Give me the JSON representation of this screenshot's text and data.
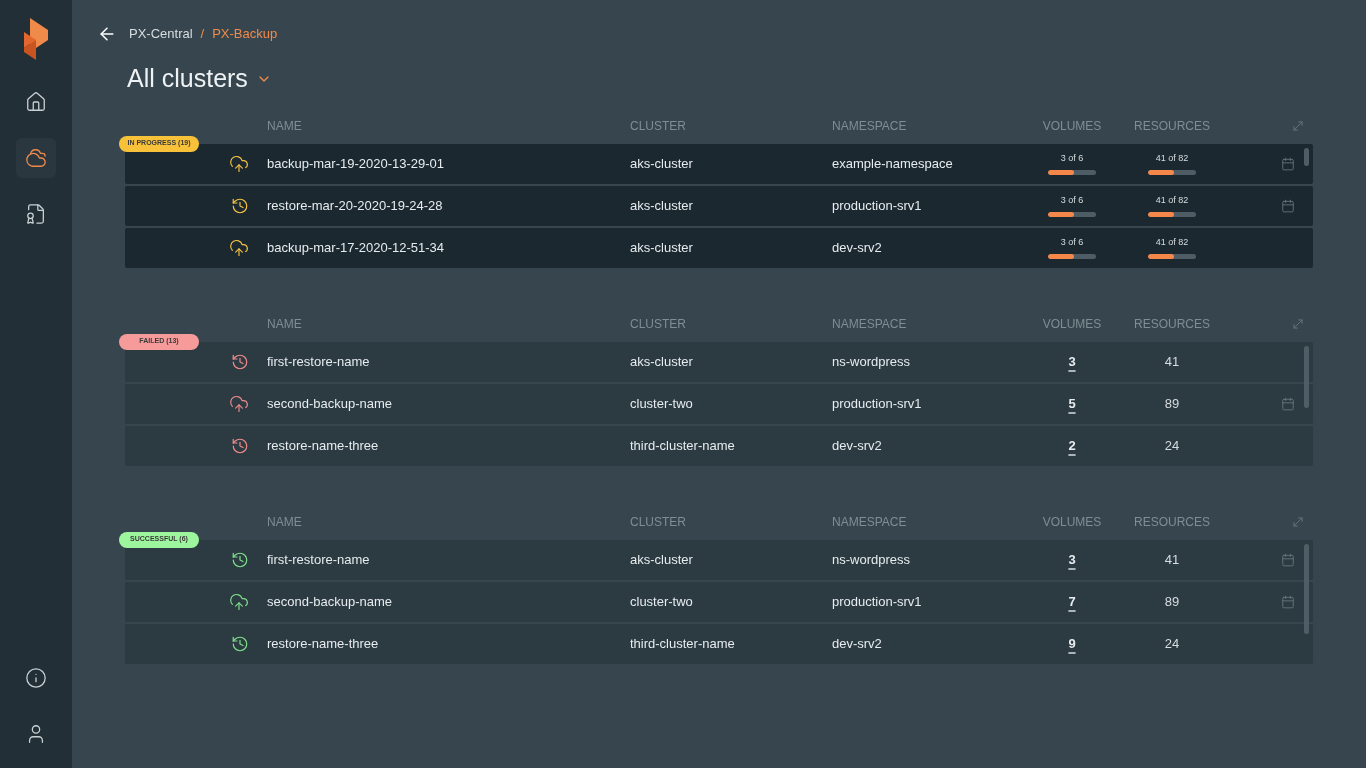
{
  "sidebar": {
    "items": [
      {
        "kind": "home",
        "selected": false
      },
      {
        "kind": "cloud",
        "selected": true
      },
      {
        "kind": "certificate",
        "selected": false
      }
    ],
    "bottom_items": [
      {
        "kind": "info"
      },
      {
        "kind": "user"
      }
    ]
  },
  "breadcrumb": {
    "separator": "/",
    "items": [
      {
        "label": "PX-Central",
        "selected": false
      },
      {
        "label": "PX-Backup",
        "selected": true
      }
    ]
  },
  "title": "All clusters",
  "sections": [
    {
      "kind": "in_progress",
      "badge": "IN PROGRESS (19)",
      "columns": [
        "NAME",
        "CLUSTER",
        "NAMESPACE",
        "VOLUMES",
        "RESOURCES"
      ],
      "rows": [
        {
          "kind": "backup",
          "name": "backup-mar-19-2020-13-29-01",
          "cluster": "aks-cluster",
          "namespace": "example-namespace",
          "volumes": {
            "kind": "progress",
            "text": "3 of 6",
            "level": 0.55
          },
          "resources": {
            "kind": "progress",
            "text": "41 of 82",
            "level": 0.55
          },
          "scheduled": true
        },
        {
          "kind": "restore",
          "name": "restore-mar-20-2020-19-24-28",
          "cluster": "aks-cluster",
          "namespace": "production-srv1",
          "volumes": {
            "kind": "progress",
            "text": "3 of 6",
            "level": 0.55
          },
          "resources": {
            "kind": "progress",
            "text": "41 of 82",
            "level": 0.55
          },
          "scheduled": true
        },
        {
          "kind": "backup",
          "name": "backup-mar-17-2020-12-51-34",
          "cluster": "aks-cluster",
          "namespace": "dev-srv2",
          "volumes": {
            "kind": "progress",
            "text": "3 of 6",
            "level": 0.55
          },
          "resources": {
            "kind": "progress",
            "text": "41 of 82",
            "level": 0.55
          },
          "scheduled": false
        }
      ]
    },
    {
      "kind": "failed",
      "badge": "FAILED (13)",
      "columns": [
        "NAME",
        "CLUSTER",
        "NAMESPACE",
        "VOLUMES",
        "RESOURCES"
      ],
      "rows": [
        {
          "kind": "restore",
          "name": "first-restore-name",
          "cluster": "aks-cluster",
          "namespace": "ns-wordpress",
          "volumes": {
            "kind": "link",
            "text": "3"
          },
          "resources": {
            "kind": "text",
            "text": "41"
          },
          "scheduled": false
        },
        {
          "kind": "backup",
          "name": "second-backup-name",
          "cluster": "cluster-two",
          "namespace": "production-srv1",
          "volumes": {
            "kind": "link",
            "text": "5"
          },
          "resources": {
            "kind": "text",
            "text": "89"
          },
          "scheduled": true
        },
        {
          "kind": "restore",
          "name": "restore-name-three",
          "cluster": "third-cluster-name",
          "namespace": "dev-srv2",
          "volumes": {
            "kind": "link",
            "text": "2"
          },
          "resources": {
            "kind": "text",
            "text": "24"
          },
          "scheduled": false
        }
      ]
    },
    {
      "kind": "successful",
      "badge": "SUCCESSFUL (6)",
      "columns": [
        "NAME",
        "CLUSTER",
        "NAMESPACE",
        "VOLUMES",
        "RESOURCES"
      ],
      "rows": [
        {
          "kind": "restore",
          "name": "first-restore-name",
          "cluster": "aks-cluster",
          "namespace": "ns-wordpress",
          "volumes": {
            "kind": "link",
            "text": "3"
          },
          "resources": {
            "kind": "text",
            "text": "41"
          },
          "scheduled": true
        },
        {
          "kind": "backup",
          "name": "second-backup-name",
          "cluster": "cluster-two",
          "namespace": "production-srv1",
          "volumes": {
            "kind": "link",
            "text": "7"
          },
          "resources": {
            "kind": "text",
            "text": "89"
          },
          "scheduled": true
        },
        {
          "kind": "restore",
          "name": "restore-name-three",
          "cluster": "third-cluster-name",
          "namespace": "dev-srv2",
          "volumes": {
            "kind": "link",
            "text": "9"
          },
          "resources": {
            "kind": "text",
            "text": "24"
          },
          "scheduled": false
        }
      ]
    }
  ]
}
